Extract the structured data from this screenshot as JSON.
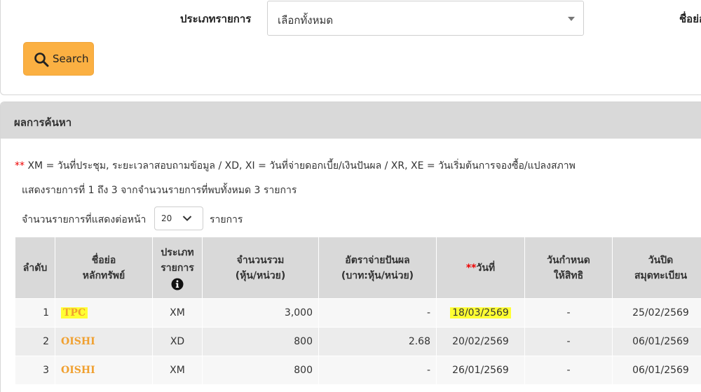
{
  "search": {
    "type_label": "ประเภทรายการ",
    "type_value": "เลือกทั้งหมด",
    "abbr_label": "ชื่อย่อ",
    "button_label": "Search",
    "accent": "#fbb042"
  },
  "results": {
    "title": "ผลการค้นหา",
    "note_star": "**",
    "note_text": " XM = วันที่ประชุม, ระยะเวลาสอบถามข้อมูล / XD, XI = วันที่จ่ายดอกเบี้ย/เงินปันผล / XR, XE = วันเริ่มต้นการจองซื้อ/แปลงสภาพ",
    "summary": "แสดงรายการที่ 1 ถึง 3 จากจำนวนรายการที่พบทั้งหมด 3 รายการ",
    "per_page_label": "จำนวนรายการที่แสดงต่อหน้า",
    "per_page_value": "20",
    "per_page_unit": "รายการ",
    "columns": {
      "no": "ลำดับ",
      "symbol_1": "ชื่อย่อ",
      "symbol_2": "หลักทรัพย์",
      "type_1": "ประเภท",
      "type_2": "รายการ",
      "total_1": "จำนวนรวม",
      "total_2": "(หุ้น/หน่วย)",
      "rate_1": "อัตราจ่ายปันผล",
      "rate_2": "(บาท:หุ้น/หน่วย)",
      "date_star": "**",
      "date": "วันที่",
      "rights_1": "วันกำหนด",
      "rights_2": "ให้สิทธิ",
      "book_1": "วันปิด",
      "book_2": "สมุดทะเบียน"
    },
    "rows": [
      {
        "no": "1",
        "symbol": "TPC",
        "type": "XM",
        "total": "3,000",
        "rate": "-",
        "date": "18/03/2569",
        "rights": "-",
        "book": "25/02/2569"
      },
      {
        "no": "2",
        "symbol": "OISHI",
        "type": "XD",
        "total": "800",
        "rate": "2.68",
        "date": "20/02/2569",
        "rights": "-",
        "book": "06/01/2569"
      },
      {
        "no": "3",
        "symbol": "OISHI",
        "type": "XM",
        "total": "800",
        "rate": "-",
        "date": "26/01/2569",
        "rights": "-",
        "book": "06/01/2569"
      }
    ],
    "highlight_color": "#ffff33",
    "symbol_color": "#f0a030"
  }
}
